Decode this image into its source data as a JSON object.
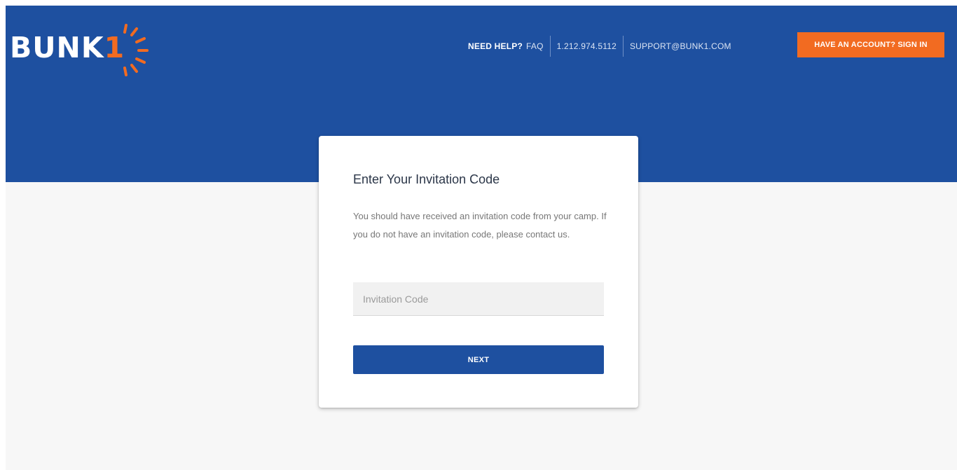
{
  "brand": {
    "name_main": "BUNK",
    "name_accent": "1",
    "accent_color": "#f26b21",
    "primary_color": "#1e50a0"
  },
  "nav": {
    "help_label": "NEED HELP?",
    "faq_label": "FAQ",
    "phone": "1.212.974.5112",
    "email": "SUPPORT@BUNK1.COM",
    "signin_label": "HAVE AN ACCOUNT? SIGN IN"
  },
  "card": {
    "title": "Enter Your Invitation Code",
    "description": "You should have received an invitation code from your camp. If you do not have an invitation code, please contact us.",
    "code_input": {
      "value": "",
      "placeholder": "Invitation Code"
    },
    "next_label": "NEXT"
  }
}
